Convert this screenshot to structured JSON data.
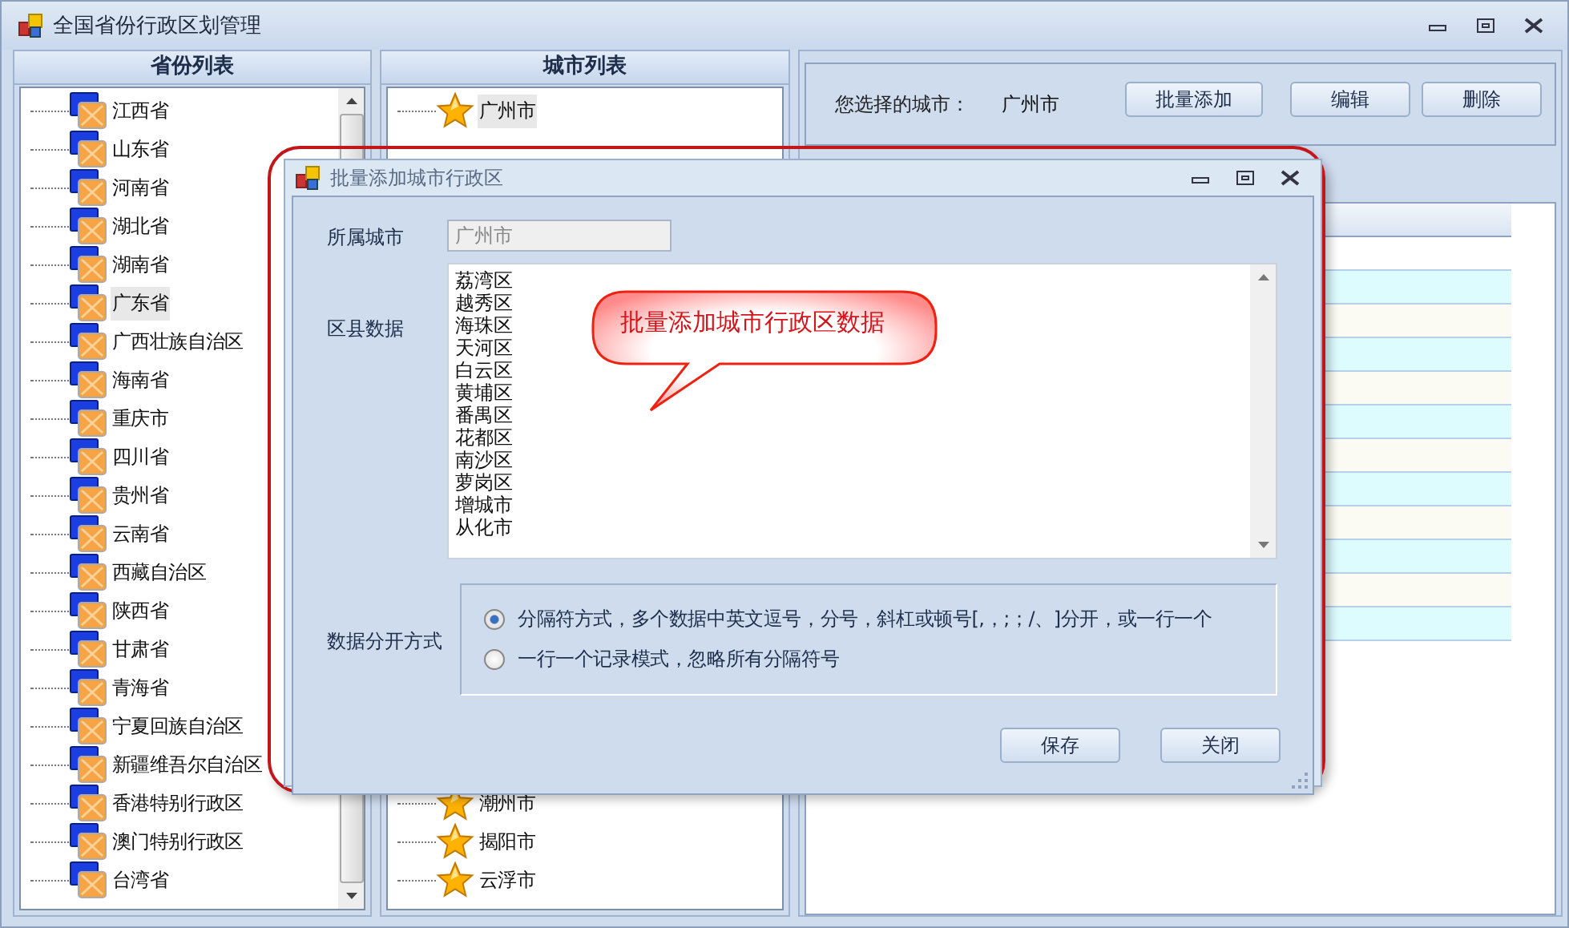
{
  "window": {
    "title": "全国省份行政区划管理"
  },
  "province_panel": {
    "title": "省份列表",
    "items": [
      {
        "label": "江西省",
        "selected": false
      },
      {
        "label": "山东省",
        "selected": false
      },
      {
        "label": "河南省",
        "selected": false
      },
      {
        "label": "湖北省",
        "selected": false
      },
      {
        "label": "湖南省",
        "selected": false
      },
      {
        "label": "广东省",
        "selected": true
      },
      {
        "label": "广西壮族自治区",
        "selected": false
      },
      {
        "label": "海南省",
        "selected": false
      },
      {
        "label": "重庆市",
        "selected": false
      },
      {
        "label": "四川省",
        "selected": false
      },
      {
        "label": "贵州省",
        "selected": false
      },
      {
        "label": "云南省",
        "selected": false
      },
      {
        "label": "西藏自治区",
        "selected": false
      },
      {
        "label": "陕西省",
        "selected": false
      },
      {
        "label": "甘肃省",
        "selected": false
      },
      {
        "label": "青海省",
        "selected": false
      },
      {
        "label": "宁夏回族自治区",
        "selected": false
      },
      {
        "label": "新疆维吾尔自治区",
        "selected": false
      },
      {
        "label": "香港特别行政区",
        "selected": false
      },
      {
        "label": "澳门特别行政区",
        "selected": false
      },
      {
        "label": "台湾省",
        "selected": false
      }
    ]
  },
  "city_panel": {
    "title": "城市列表",
    "items": [
      {
        "label": "广州市",
        "selected": true
      },
      {
        "label": "潮州市",
        "selected": false
      },
      {
        "label": "揭阳市",
        "selected": false
      },
      {
        "label": "云浮市",
        "selected": false
      }
    ]
  },
  "city_toolbar": {
    "label": "您选择的城市：",
    "value": "广州市",
    "buttons": [
      "批量添加",
      "编辑",
      "删除"
    ]
  },
  "dialog": {
    "title": "批量添加城市行政区",
    "city_label": "所属城市",
    "city_value": "广州市",
    "districts_label": "区县数据",
    "districts": [
      "荔湾区",
      "越秀区",
      "海珠区",
      "天河区",
      "白云区",
      "黄埔区",
      "番禺区",
      "花都区",
      "南沙区",
      "萝岗区",
      "增城市",
      "从化市"
    ],
    "split_label": "数据分开方式",
    "split_options": [
      {
        "label": "分隔符方式，多个数据中英文逗号，分号，斜杠或顿号[,，;；/、]分开，或一行一个",
        "selected": true
      },
      {
        "label": "一行一个记录模式，忽略所有分隔符号",
        "selected": false
      }
    ],
    "buttons": [
      "保存",
      "关闭"
    ]
  },
  "annotation": {
    "text": "批量添加城市行政区数据"
  }
}
